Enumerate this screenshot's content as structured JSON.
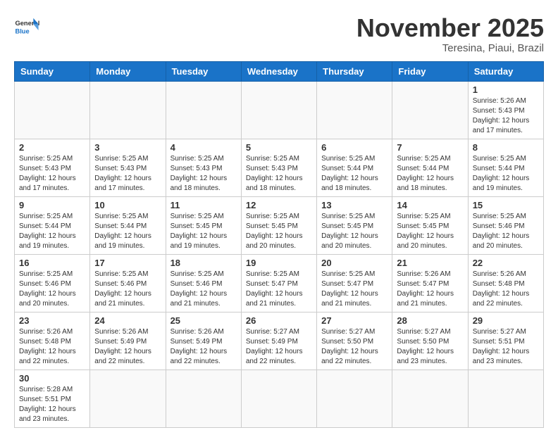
{
  "header": {
    "logo_general": "General",
    "logo_blue": "Blue",
    "month_title": "November 2025",
    "location": "Teresina, Piaui, Brazil"
  },
  "weekdays": [
    "Sunday",
    "Monday",
    "Tuesday",
    "Wednesday",
    "Thursday",
    "Friday",
    "Saturday"
  ],
  "weeks": [
    [
      {
        "day": "",
        "info": ""
      },
      {
        "day": "",
        "info": ""
      },
      {
        "day": "",
        "info": ""
      },
      {
        "day": "",
        "info": ""
      },
      {
        "day": "",
        "info": ""
      },
      {
        "day": "",
        "info": ""
      },
      {
        "day": "1",
        "info": "Sunrise: 5:26 AM\nSunset: 5:43 PM\nDaylight: 12 hours and 17 minutes."
      }
    ],
    [
      {
        "day": "2",
        "info": "Sunrise: 5:25 AM\nSunset: 5:43 PM\nDaylight: 12 hours and 17 minutes."
      },
      {
        "day": "3",
        "info": "Sunrise: 5:25 AM\nSunset: 5:43 PM\nDaylight: 12 hours and 17 minutes."
      },
      {
        "day": "4",
        "info": "Sunrise: 5:25 AM\nSunset: 5:43 PM\nDaylight: 12 hours and 18 minutes."
      },
      {
        "day": "5",
        "info": "Sunrise: 5:25 AM\nSunset: 5:43 PM\nDaylight: 12 hours and 18 minutes."
      },
      {
        "day": "6",
        "info": "Sunrise: 5:25 AM\nSunset: 5:44 PM\nDaylight: 12 hours and 18 minutes."
      },
      {
        "day": "7",
        "info": "Sunrise: 5:25 AM\nSunset: 5:44 PM\nDaylight: 12 hours and 18 minutes."
      },
      {
        "day": "8",
        "info": "Sunrise: 5:25 AM\nSunset: 5:44 PM\nDaylight: 12 hours and 19 minutes."
      }
    ],
    [
      {
        "day": "9",
        "info": "Sunrise: 5:25 AM\nSunset: 5:44 PM\nDaylight: 12 hours and 19 minutes."
      },
      {
        "day": "10",
        "info": "Sunrise: 5:25 AM\nSunset: 5:44 PM\nDaylight: 12 hours and 19 minutes."
      },
      {
        "day": "11",
        "info": "Sunrise: 5:25 AM\nSunset: 5:45 PM\nDaylight: 12 hours and 19 minutes."
      },
      {
        "day": "12",
        "info": "Sunrise: 5:25 AM\nSunset: 5:45 PM\nDaylight: 12 hours and 20 minutes."
      },
      {
        "day": "13",
        "info": "Sunrise: 5:25 AM\nSunset: 5:45 PM\nDaylight: 12 hours and 20 minutes."
      },
      {
        "day": "14",
        "info": "Sunrise: 5:25 AM\nSunset: 5:45 PM\nDaylight: 12 hours and 20 minutes."
      },
      {
        "day": "15",
        "info": "Sunrise: 5:25 AM\nSunset: 5:46 PM\nDaylight: 12 hours and 20 minutes."
      }
    ],
    [
      {
        "day": "16",
        "info": "Sunrise: 5:25 AM\nSunset: 5:46 PM\nDaylight: 12 hours and 20 minutes."
      },
      {
        "day": "17",
        "info": "Sunrise: 5:25 AM\nSunset: 5:46 PM\nDaylight: 12 hours and 21 minutes."
      },
      {
        "day": "18",
        "info": "Sunrise: 5:25 AM\nSunset: 5:46 PM\nDaylight: 12 hours and 21 minutes."
      },
      {
        "day": "19",
        "info": "Sunrise: 5:25 AM\nSunset: 5:47 PM\nDaylight: 12 hours and 21 minutes."
      },
      {
        "day": "20",
        "info": "Sunrise: 5:25 AM\nSunset: 5:47 PM\nDaylight: 12 hours and 21 minutes."
      },
      {
        "day": "21",
        "info": "Sunrise: 5:26 AM\nSunset: 5:47 PM\nDaylight: 12 hours and 21 minutes."
      },
      {
        "day": "22",
        "info": "Sunrise: 5:26 AM\nSunset: 5:48 PM\nDaylight: 12 hours and 22 minutes."
      }
    ],
    [
      {
        "day": "23",
        "info": "Sunrise: 5:26 AM\nSunset: 5:48 PM\nDaylight: 12 hours and 22 minutes."
      },
      {
        "day": "24",
        "info": "Sunrise: 5:26 AM\nSunset: 5:49 PM\nDaylight: 12 hours and 22 minutes."
      },
      {
        "day": "25",
        "info": "Sunrise: 5:26 AM\nSunset: 5:49 PM\nDaylight: 12 hours and 22 minutes."
      },
      {
        "day": "26",
        "info": "Sunrise: 5:27 AM\nSunset: 5:49 PM\nDaylight: 12 hours and 22 minutes."
      },
      {
        "day": "27",
        "info": "Sunrise: 5:27 AM\nSunset: 5:50 PM\nDaylight: 12 hours and 22 minutes."
      },
      {
        "day": "28",
        "info": "Sunrise: 5:27 AM\nSunset: 5:50 PM\nDaylight: 12 hours and 23 minutes."
      },
      {
        "day": "29",
        "info": "Sunrise: 5:27 AM\nSunset: 5:51 PM\nDaylight: 12 hours and 23 minutes."
      }
    ],
    [
      {
        "day": "30",
        "info": "Sunrise: 5:28 AM\nSunset: 5:51 PM\nDaylight: 12 hours and 23 minutes."
      },
      {
        "day": "",
        "info": ""
      },
      {
        "day": "",
        "info": ""
      },
      {
        "day": "",
        "info": ""
      },
      {
        "day": "",
        "info": ""
      },
      {
        "day": "",
        "info": ""
      },
      {
        "day": "",
        "info": ""
      }
    ]
  ]
}
